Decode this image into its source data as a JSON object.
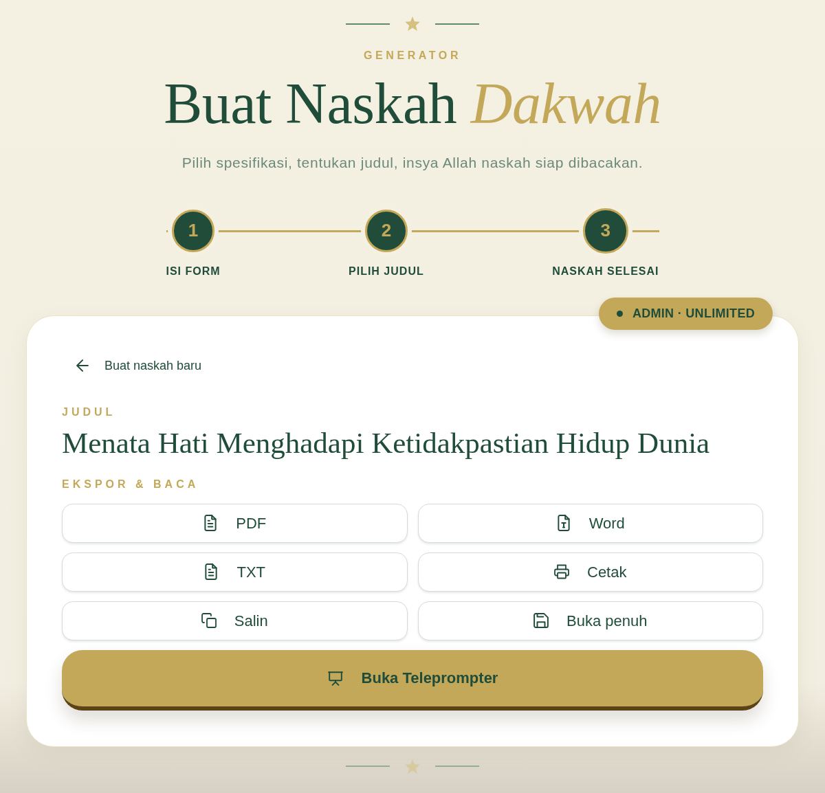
{
  "header": {
    "eyebrow": "GENERATOR",
    "title": "Buat Naskah *Dakwah*",
    "subtitle": "Pilih spesifikasi, tentukan judul, insya Allah naskah siap dibacakan."
  },
  "steps": [
    {
      "number": "1",
      "label": "ISI FORM",
      "selected": false
    },
    {
      "number": "2",
      "label": "PILIH JUDUL",
      "selected": false
    },
    {
      "number": "3",
      "label": "NASKAH SELESAI",
      "selected": true
    }
  ],
  "badge": {
    "text": "ADMIN · UNLIMITED"
  },
  "back_link": {
    "label": "Buat naskah baru"
  },
  "script": {
    "title_label": "JUDUL",
    "title": "Menata Hati Menghadapi Ketidakpastian Hidup Dunia"
  },
  "export": {
    "label": "EKSPOR & BACA",
    "buttons": [
      {
        "kind": "pdf",
        "label": "PDF"
      },
      {
        "kind": "word",
        "label": "Word"
      },
      {
        "kind": "txt",
        "label": "TXT"
      },
      {
        "kind": "print",
        "label": "Cetak"
      },
      {
        "kind": "copy",
        "label": "Salin"
      },
      {
        "kind": "save",
        "label": "Buka penuh"
      }
    ]
  },
  "primary_button": {
    "label": "Buka Teleprompter"
  }
}
